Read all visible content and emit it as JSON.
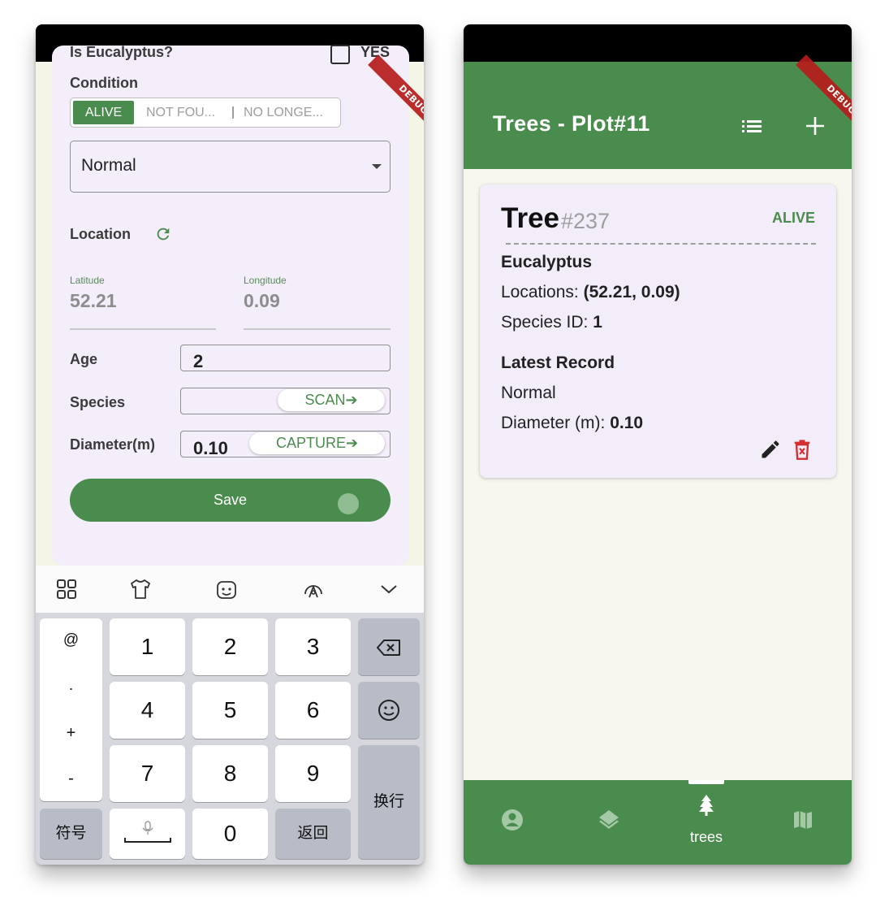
{
  "left_screen": {
    "debug_banner": "DEBUG",
    "form": {
      "eucalyptus_label": "Is Eucalyptus?",
      "eucalyptus_option": "YES",
      "condition_label": "Condition",
      "condition_options": [
        "ALIVE",
        "NOT FOU...",
        "NO LONGE..."
      ],
      "condition_selected": "ALIVE",
      "status_dropdown_value": "Normal",
      "location_label": "Location",
      "latitude_label": "Latitude",
      "latitude_value": "52.21",
      "longitude_label": "Longitude",
      "longitude_value": "0.09",
      "age_label": "Age",
      "age_value": "2",
      "species_label": "Species",
      "scan_button": "SCAN➔",
      "diameter_label": "Diameter(m)",
      "diameter_value": "0.10",
      "capture_button": "CAPTURE➔",
      "save_button": "Save"
    },
    "keyboard": {
      "toolbar_icons": [
        "grid-icon",
        "shirt-icon",
        "emoji-sticker-icon",
        "voice-assistant-icon",
        "chevron-down-icon"
      ],
      "symbols_column": [
        "@",
        ".",
        "+",
        "-"
      ],
      "digits": [
        "1",
        "2",
        "3",
        "4",
        "5",
        "6",
        "7",
        "8",
        "9",
        "0"
      ],
      "symbol_key": "符号",
      "return_key": "返回",
      "enter_key": "换行"
    }
  },
  "right_screen": {
    "debug_banner": "DEBUG",
    "app_title": "Trees - Plot#11",
    "tree_card": {
      "title": "Tree",
      "number": "#237",
      "status": "ALIVE",
      "species_name": "Eucalyptus",
      "locations_label": "Locations: ",
      "locations_value": "(52.21, 0.09)",
      "species_id_label": "Species ID: ",
      "species_id_value": "1",
      "latest_record_heading": "Latest Record",
      "latest_record_status": "Normal",
      "diameter_label": "Diameter (m): ",
      "diameter_value": "0.10"
    },
    "bottom_nav": {
      "active_label": "trees",
      "items": [
        "profile-icon",
        "layers-icon",
        "tree-icon",
        "map-icon"
      ]
    }
  },
  "colors": {
    "primary_green": "#4a8c4d",
    "card_lavender": "#f2edf8",
    "delete_red": "#d32f2f",
    "debug_red": "#b71c1c"
  }
}
